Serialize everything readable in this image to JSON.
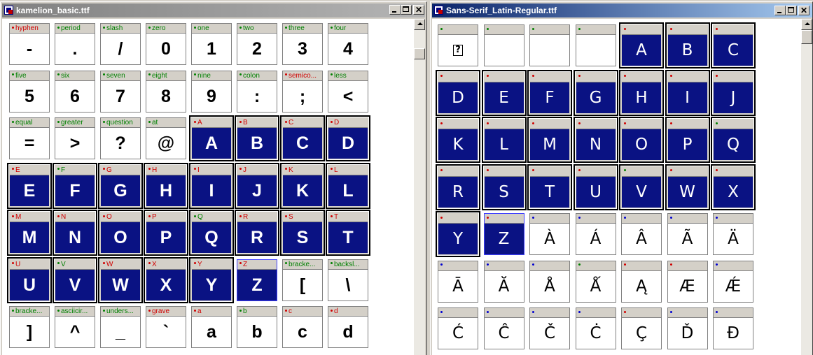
{
  "colors": {
    "red_dot": "#d00000",
    "green_dot": "#008000",
    "blue_dot": "#0000d0",
    "selected_bg": "#0a1283"
  },
  "window1": {
    "title": "kamelion_basic.ttf",
    "cells": [
      {
        "label": "hyphen",
        "glyph": "-",
        "mark": "red",
        "state": ""
      },
      {
        "label": "period",
        "glyph": ".",
        "mark": "green",
        "state": ""
      },
      {
        "label": "slash",
        "glyph": "/",
        "mark": "green",
        "state": ""
      },
      {
        "label": "zero",
        "glyph": "0",
        "mark": "green",
        "state": ""
      },
      {
        "label": "one",
        "glyph": "1",
        "mark": "green",
        "state": ""
      },
      {
        "label": "two",
        "glyph": "2",
        "mark": "green",
        "state": ""
      },
      {
        "label": "three",
        "glyph": "3",
        "mark": "green",
        "state": ""
      },
      {
        "label": "four",
        "glyph": "4",
        "mark": "green",
        "state": ""
      },
      {
        "label": "five",
        "glyph": "5",
        "mark": "green",
        "state": ""
      },
      {
        "label": "six",
        "glyph": "6",
        "mark": "green",
        "state": ""
      },
      {
        "label": "seven",
        "glyph": "7",
        "mark": "green",
        "state": ""
      },
      {
        "label": "eight",
        "glyph": "8",
        "mark": "green",
        "state": ""
      },
      {
        "label": "nine",
        "glyph": "9",
        "mark": "green",
        "state": ""
      },
      {
        "label": "colon",
        "glyph": ":",
        "mark": "green",
        "state": ""
      },
      {
        "label": "semico...",
        "glyph": ";",
        "mark": "red",
        "state": ""
      },
      {
        "label": "less",
        "glyph": "<",
        "mark": "green",
        "state": ""
      },
      {
        "label": "equal",
        "glyph": "=",
        "mark": "green",
        "state": ""
      },
      {
        "label": "greater",
        "glyph": ">",
        "mark": "green",
        "state": ""
      },
      {
        "label": "question",
        "glyph": "?",
        "mark": "green",
        "state": ""
      },
      {
        "label": "at",
        "glyph": "@",
        "mark": "green",
        "state": ""
      },
      {
        "label": "A",
        "glyph": "A",
        "mark": "red",
        "state": "sel"
      },
      {
        "label": "B",
        "glyph": "B",
        "mark": "red",
        "state": "sel"
      },
      {
        "label": "C",
        "glyph": "C",
        "mark": "red",
        "state": "sel"
      },
      {
        "label": "D",
        "glyph": "D",
        "mark": "red",
        "state": "sel"
      },
      {
        "label": "E",
        "glyph": "E",
        "mark": "red",
        "state": "sel"
      },
      {
        "label": "F",
        "glyph": "F",
        "mark": "green",
        "state": "sel"
      },
      {
        "label": "G",
        "glyph": "G",
        "mark": "red",
        "state": "sel"
      },
      {
        "label": "H",
        "glyph": "H",
        "mark": "red",
        "state": "sel"
      },
      {
        "label": "I",
        "glyph": "I",
        "mark": "red",
        "state": "sel"
      },
      {
        "label": "J",
        "glyph": "J",
        "mark": "red",
        "state": "sel"
      },
      {
        "label": "K",
        "glyph": "K",
        "mark": "red",
        "state": "sel"
      },
      {
        "label": "L",
        "glyph": "L",
        "mark": "red",
        "state": "sel"
      },
      {
        "label": "M",
        "glyph": "M",
        "mark": "red",
        "state": "sel"
      },
      {
        "label": "N",
        "glyph": "N",
        "mark": "red",
        "state": "sel"
      },
      {
        "label": "O",
        "glyph": "O",
        "mark": "red",
        "state": "sel"
      },
      {
        "label": "P",
        "glyph": "P",
        "mark": "red",
        "state": "sel"
      },
      {
        "label": "Q",
        "glyph": "Q",
        "mark": "green",
        "state": "sel"
      },
      {
        "label": "R",
        "glyph": "R",
        "mark": "red",
        "state": "sel"
      },
      {
        "label": "S",
        "glyph": "S",
        "mark": "red",
        "state": "sel"
      },
      {
        "label": "T",
        "glyph": "T",
        "mark": "red",
        "state": "sel"
      },
      {
        "label": "U",
        "glyph": "U",
        "mark": "red",
        "state": "sel"
      },
      {
        "label": "V",
        "glyph": "V",
        "mark": "green",
        "state": "sel"
      },
      {
        "label": "W",
        "glyph": "W",
        "mark": "red",
        "state": "sel"
      },
      {
        "label": "X",
        "glyph": "X",
        "mark": "red",
        "state": "sel"
      },
      {
        "label": "Y",
        "glyph": "Y",
        "mark": "red",
        "state": "sel"
      },
      {
        "label": "Z",
        "glyph": "Z",
        "mark": "red",
        "state": "focus"
      },
      {
        "label": "bracke...",
        "glyph": "[",
        "mark": "green",
        "state": ""
      },
      {
        "label": "backsl...",
        "glyph": "\\",
        "mark": "green",
        "state": ""
      },
      {
        "label": "bracke...",
        "glyph": "]",
        "mark": "green",
        "state": ""
      },
      {
        "label": "asciicir...",
        "glyph": "^",
        "mark": "green",
        "state": ""
      },
      {
        "label": "unders...",
        "glyph": "_",
        "mark": "green",
        "state": ""
      },
      {
        "label": "grave",
        "glyph": "`",
        "mark": "red",
        "state": ""
      },
      {
        "label": "a",
        "glyph": "a",
        "mark": "red",
        "state": ""
      },
      {
        "label": "b",
        "glyph": "b",
        "mark": "green",
        "state": ""
      },
      {
        "label": "c",
        "glyph": "c",
        "mark": "red",
        "state": ""
      },
      {
        "label": "d",
        "glyph": "d",
        "mark": "red",
        "state": ""
      }
    ]
  },
  "window2": {
    "title": "Sans-Serif_Latin-Regular.ttf",
    "cells": [
      {
        "label": "",
        "glyph": "?",
        "mark": "green",
        "state": "ph"
      },
      {
        "label": "",
        "glyph": "",
        "mark": "green",
        "state": ""
      },
      {
        "label": "",
        "glyph": "",
        "mark": "green",
        "state": ""
      },
      {
        "label": "",
        "glyph": "",
        "mark": "green",
        "state": ""
      },
      {
        "label": "",
        "glyph": "A",
        "mark": "red",
        "state": "sel"
      },
      {
        "label": "",
        "glyph": "B",
        "mark": "red",
        "state": "sel"
      },
      {
        "label": "",
        "glyph": "C",
        "mark": "red",
        "state": "sel"
      },
      {
        "label": "",
        "glyph": "D",
        "mark": "red",
        "state": "sel"
      },
      {
        "label": "",
        "glyph": "E",
        "mark": "red",
        "state": "sel"
      },
      {
        "label": "",
        "glyph": "F",
        "mark": "red",
        "state": "sel"
      },
      {
        "label": "",
        "glyph": "G",
        "mark": "red",
        "state": "sel"
      },
      {
        "label": "",
        "glyph": "H",
        "mark": "red",
        "state": "sel"
      },
      {
        "label": "",
        "glyph": "I",
        "mark": "red",
        "state": "sel"
      },
      {
        "label": "",
        "glyph": "J",
        "mark": "red",
        "state": "sel"
      },
      {
        "label": "",
        "glyph": "K",
        "mark": "red",
        "state": "sel"
      },
      {
        "label": "",
        "glyph": "L",
        "mark": "red",
        "state": "sel"
      },
      {
        "label": "",
        "glyph": "M",
        "mark": "red",
        "state": "sel"
      },
      {
        "label": "",
        "glyph": "N",
        "mark": "red",
        "state": "sel"
      },
      {
        "label": "",
        "glyph": "O",
        "mark": "red",
        "state": "sel"
      },
      {
        "label": "",
        "glyph": "P",
        "mark": "red",
        "state": "sel"
      },
      {
        "label": "",
        "glyph": "Q",
        "mark": "green",
        "state": "sel"
      },
      {
        "label": "",
        "glyph": "R",
        "mark": "red",
        "state": "sel"
      },
      {
        "label": "",
        "glyph": "S",
        "mark": "red",
        "state": "sel"
      },
      {
        "label": "",
        "glyph": "T",
        "mark": "red",
        "state": "sel"
      },
      {
        "label": "",
        "glyph": "U",
        "mark": "red",
        "state": "sel"
      },
      {
        "label": "",
        "glyph": "V",
        "mark": "green",
        "state": "sel"
      },
      {
        "label": "",
        "glyph": "W",
        "mark": "red",
        "state": "sel"
      },
      {
        "label": "",
        "glyph": "X",
        "mark": "red",
        "state": "sel"
      },
      {
        "label": "",
        "glyph": "Y",
        "mark": "red",
        "state": "sel"
      },
      {
        "label": "",
        "glyph": "Z",
        "mark": "red",
        "state": "focus"
      },
      {
        "label": "",
        "glyph": "À",
        "mark": "blue",
        "state": ""
      },
      {
        "label": "",
        "glyph": "Á",
        "mark": "blue",
        "state": ""
      },
      {
        "label": "",
        "glyph": "Â",
        "mark": "blue",
        "state": ""
      },
      {
        "label": "",
        "glyph": "Ã",
        "mark": "blue",
        "state": ""
      },
      {
        "label": "",
        "glyph": "Ä",
        "mark": "blue",
        "state": ""
      },
      {
        "label": "",
        "glyph": "Ā",
        "mark": "blue",
        "state": ""
      },
      {
        "label": "",
        "glyph": "Ă",
        "mark": "blue",
        "state": ""
      },
      {
        "label": "",
        "glyph": "Å",
        "mark": "blue",
        "state": ""
      },
      {
        "label": "",
        "glyph": "Ǻ",
        "mark": "green",
        "state": ""
      },
      {
        "label": "",
        "glyph": "Ą",
        "mark": "red",
        "state": ""
      },
      {
        "label": "",
        "glyph": "Æ",
        "mark": "red",
        "state": ""
      },
      {
        "label": "",
        "glyph": "Ǽ",
        "mark": "blue",
        "state": ""
      },
      {
        "label": "",
        "glyph": "Ć",
        "mark": "blue",
        "state": ""
      },
      {
        "label": "",
        "glyph": "Ĉ",
        "mark": "blue",
        "state": ""
      },
      {
        "label": "",
        "glyph": "Č",
        "mark": "blue",
        "state": ""
      },
      {
        "label": "",
        "glyph": "Ċ",
        "mark": "blue",
        "state": ""
      },
      {
        "label": "",
        "glyph": "Ç",
        "mark": "red",
        "state": ""
      },
      {
        "label": "",
        "glyph": "Ď",
        "mark": "blue",
        "state": ""
      },
      {
        "label": "",
        "glyph": "Đ",
        "mark": "blue",
        "state": ""
      }
    ]
  }
}
